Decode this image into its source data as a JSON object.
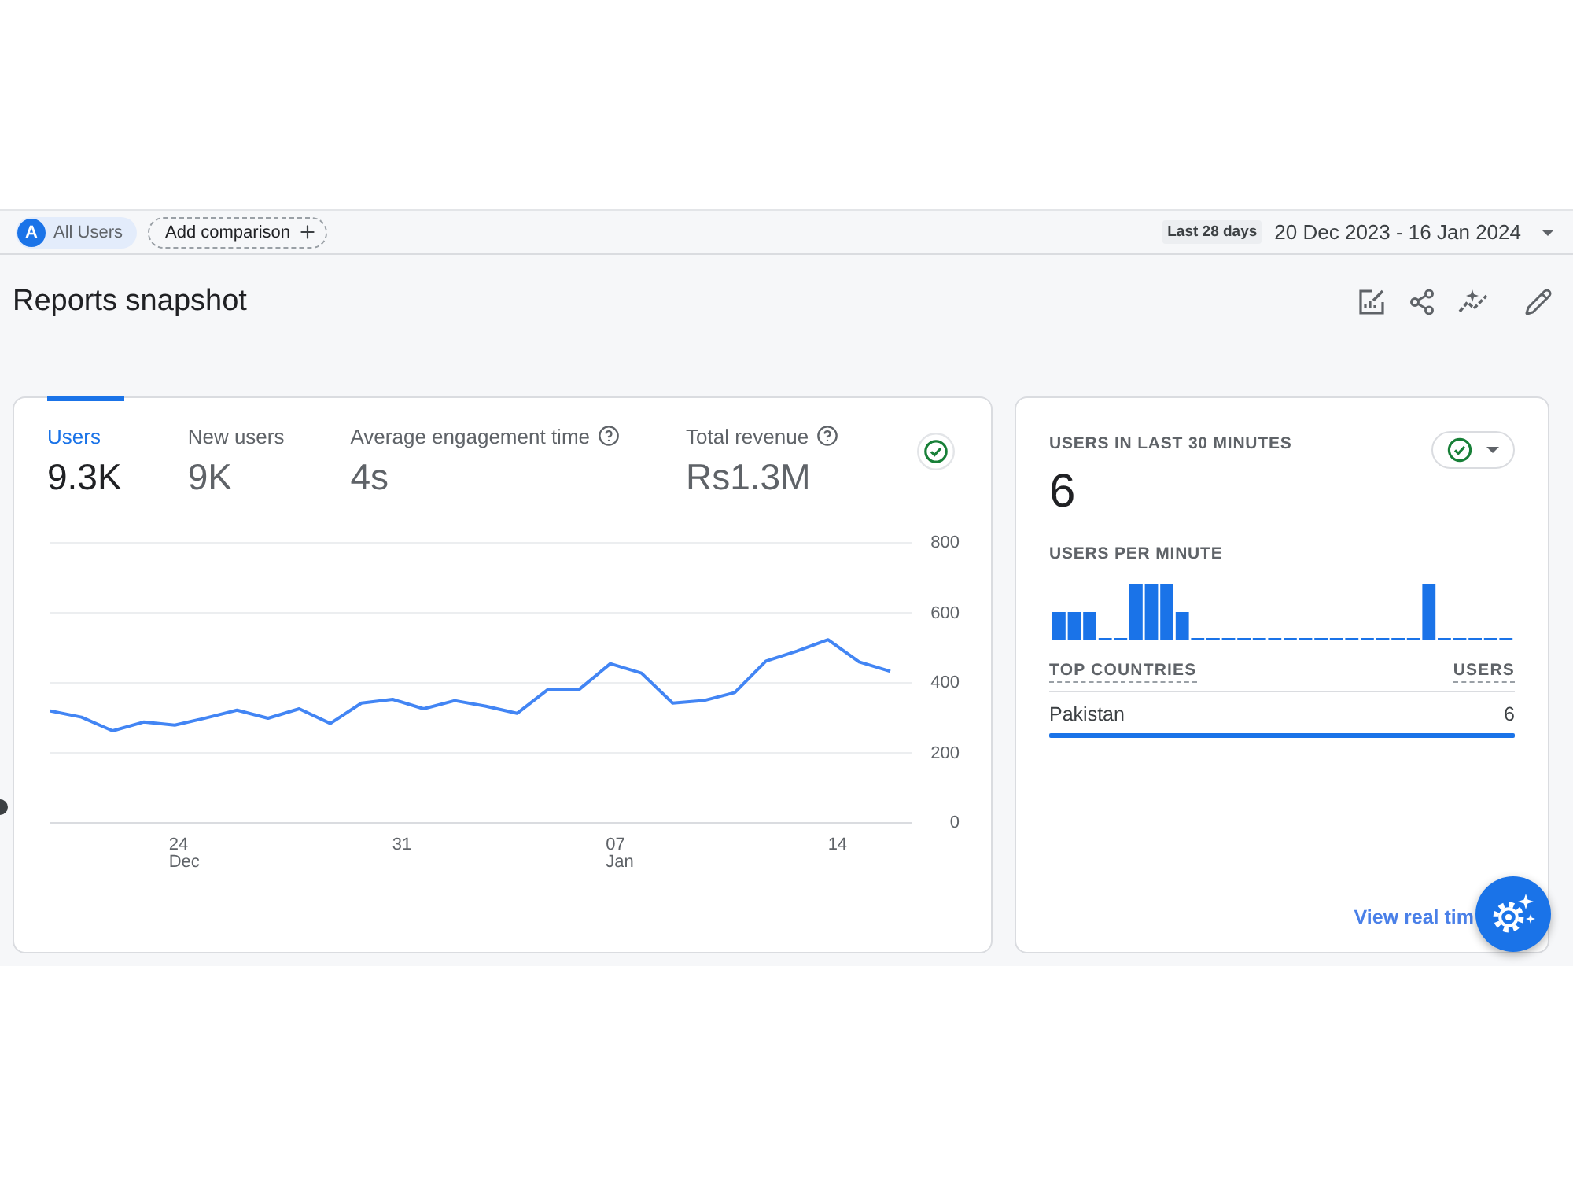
{
  "comparison_bar": {
    "segment": {
      "avatar": "A",
      "label": "All Users"
    },
    "add_comparison": "Add comparison"
  },
  "date_range": {
    "preset": "Last 28 days",
    "range": "20 Dec 2023 - 16 Jan 2024"
  },
  "page_title": "Reports snapshot",
  "metrics_card": {
    "metrics": [
      {
        "label": "Users",
        "value": "9.3K",
        "selected": true,
        "help": false
      },
      {
        "label": "New users",
        "value": "9K",
        "selected": false,
        "help": false
      },
      {
        "label": "Average engagement time",
        "value": "4s",
        "selected": false,
        "help": true
      },
      {
        "label": "Total revenue",
        "value": "Rs1.3M",
        "selected": false,
        "help": true
      }
    ],
    "chart_data": {
      "type": "line",
      "categories": [
        null,
        null,
        null,
        null,
        "24 Dec",
        null,
        null,
        null,
        null,
        null,
        null,
        "31",
        null,
        null,
        null,
        null,
        null,
        null,
        "07 Jan",
        null,
        null,
        null,
        null,
        null,
        null,
        "14",
        null,
        null
      ],
      "series": [
        {
          "color": "#4285f4",
          "values": [
            320,
            302,
            263,
            288,
            279,
            300,
            322,
            299,
            326,
            284,
            342,
            353,
            326,
            349,
            333,
            313,
            381,
            381,
            455,
            428,
            342,
            349,
            372,
            462,
            491,
            523,
            460,
            433
          ]
        }
      ],
      "ylim": [
        0,
        800
      ],
      "yticks": [
        0,
        200,
        400,
        600,
        800
      ],
      "grid": true
    }
  },
  "realtime_card": {
    "title": "USERS IN LAST 30 MINUTES",
    "value": "6",
    "per_minute_label": "USERS PER MINUTE",
    "table": {
      "columns": [
        "TOP COUNTRIES",
        "USERS"
      ],
      "rows": [
        {
          "country": "Pakistan",
          "users": "6",
          "level": 1
        }
      ]
    },
    "link": "View real tim"
  }
}
